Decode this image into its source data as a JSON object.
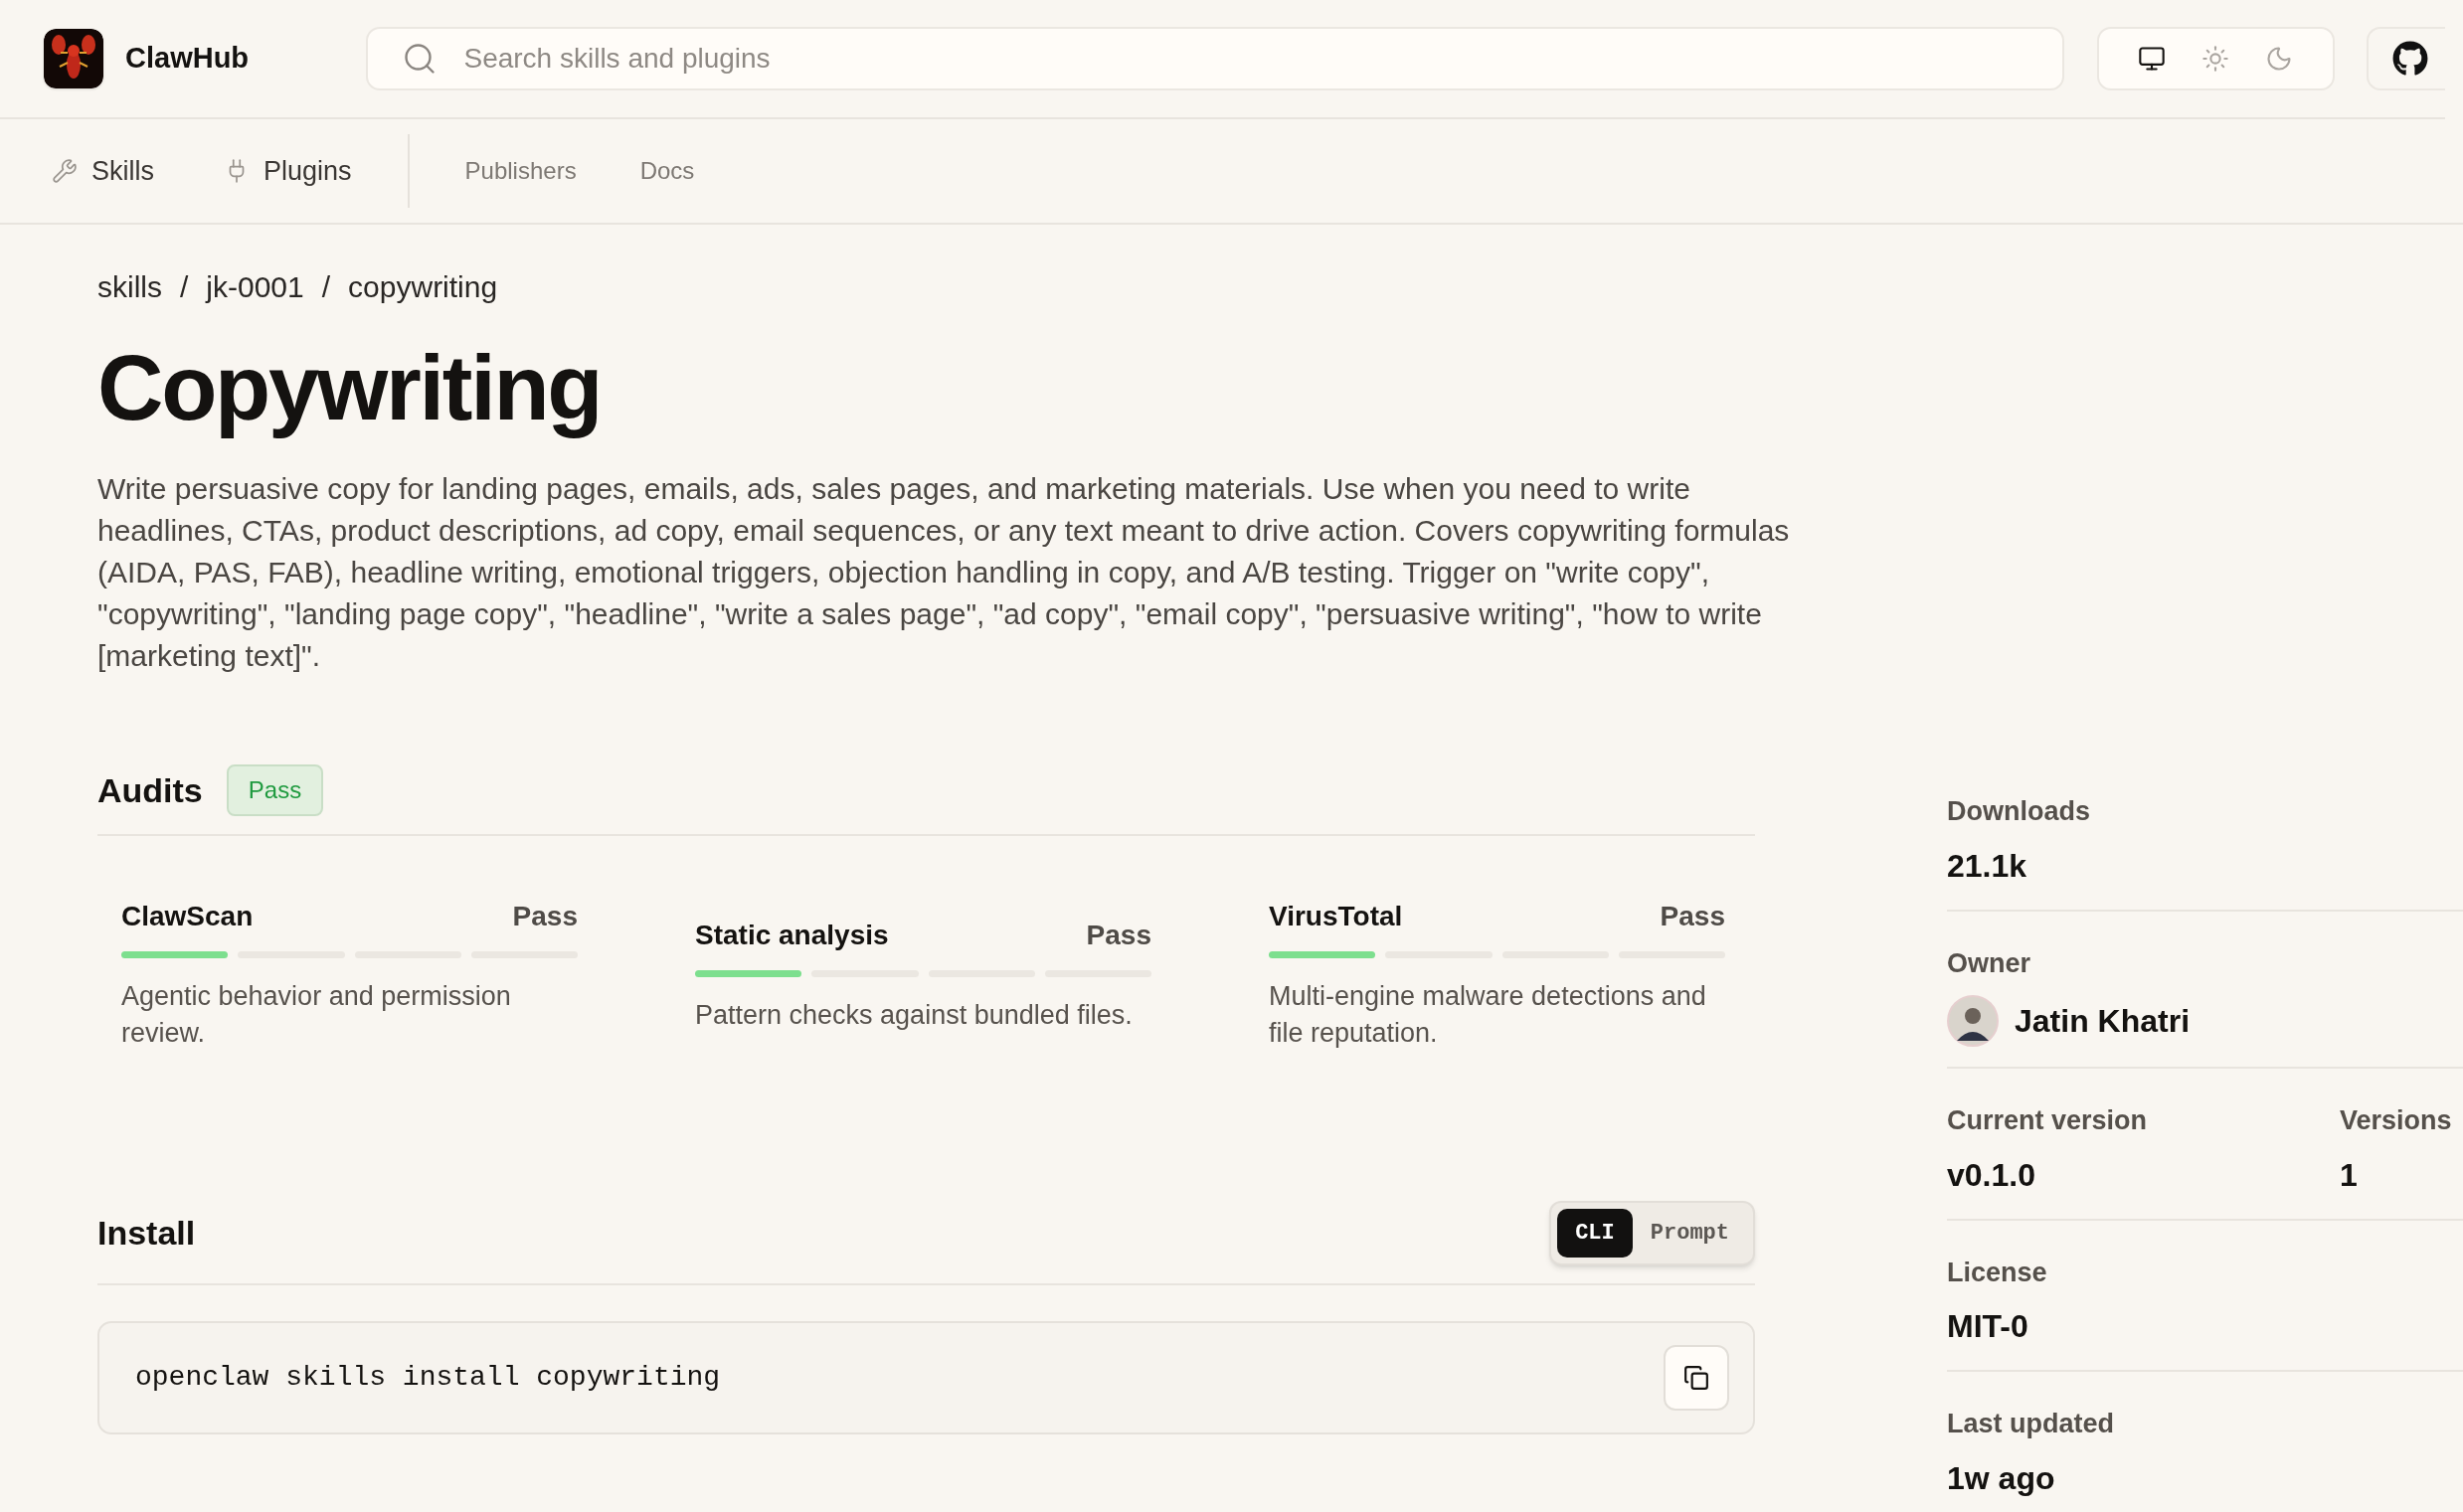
{
  "header": {
    "brand": "ClawHub",
    "search": {
      "placeholder": "Search skills and plugins"
    },
    "theme_switcher": [
      {
        "selected": true
      },
      {
        "selected": false
      },
      {
        "selected": false
      }
    ]
  },
  "nav": [
    {
      "label": "Skills",
      "kind": "primary"
    },
    {
      "label": "Plugins",
      "kind": "primary"
    },
    {
      "label": "Publishers",
      "kind": "secondary"
    },
    {
      "label": "Docs",
      "kind": "secondary"
    }
  ],
  "breadcrumb": {
    "separator": "/",
    "items": [
      "skills",
      "jk-0001",
      "copywriting"
    ]
  },
  "title": "Copywriting",
  "description": "Write persuasive copy for landing pages, emails, ads, sales pages, and marketing materials. Use when you need to write headlines, CTAs, product descriptions, ad copy, email sequences, or any text meant to drive action. Covers copywriting formulas (AIDA, PAS, FAB), headline writing, emotional triggers, objection handling in copy, and A/B testing. Trigger on \"write copy\", \"copywriting\", \"landing page copy\", \"headline\", \"write a sales page\", \"ad copy\", \"email copy\", \"persuasive writing\", \"how to write [marketing text]\".",
  "audits": {
    "heading": "Audits",
    "badge": "Pass",
    "items": [
      {
        "name": "ClawScan",
        "status": "Pass",
        "level": 0.25,
        "description": "Agentic behavior and permission review."
      },
      {
        "name": "Static analysis",
        "status": "Pass",
        "level": 0.25,
        "description": "Pattern checks against bundled files."
      },
      {
        "name": "VirusTotal",
        "status": "Pass",
        "level": 0.25,
        "description": "Multi-engine malware detections and file reputation."
      }
    ]
  },
  "install": {
    "heading": "Install",
    "modes": [
      {
        "label": "CLI",
        "selected": true
      },
      {
        "label": "Prompt",
        "selected": false
      }
    ],
    "command": "openclaw skills install copywriting"
  },
  "sidebar": [
    {
      "kind": "stat",
      "label": "Downloads",
      "value": "21.1k"
    },
    {
      "kind": "owner",
      "label": "Owner",
      "value": "Jatin Khatri"
    },
    {
      "kind": "pair",
      "label": "Current version",
      "value": "v0.1.0",
      "label_2": "Versions",
      "value_2": "1"
    },
    {
      "kind": "stat",
      "label": "License",
      "value": "MIT-0"
    },
    {
      "kind": "stat",
      "label": "Last updated",
      "value": "1w ago"
    }
  ]
}
